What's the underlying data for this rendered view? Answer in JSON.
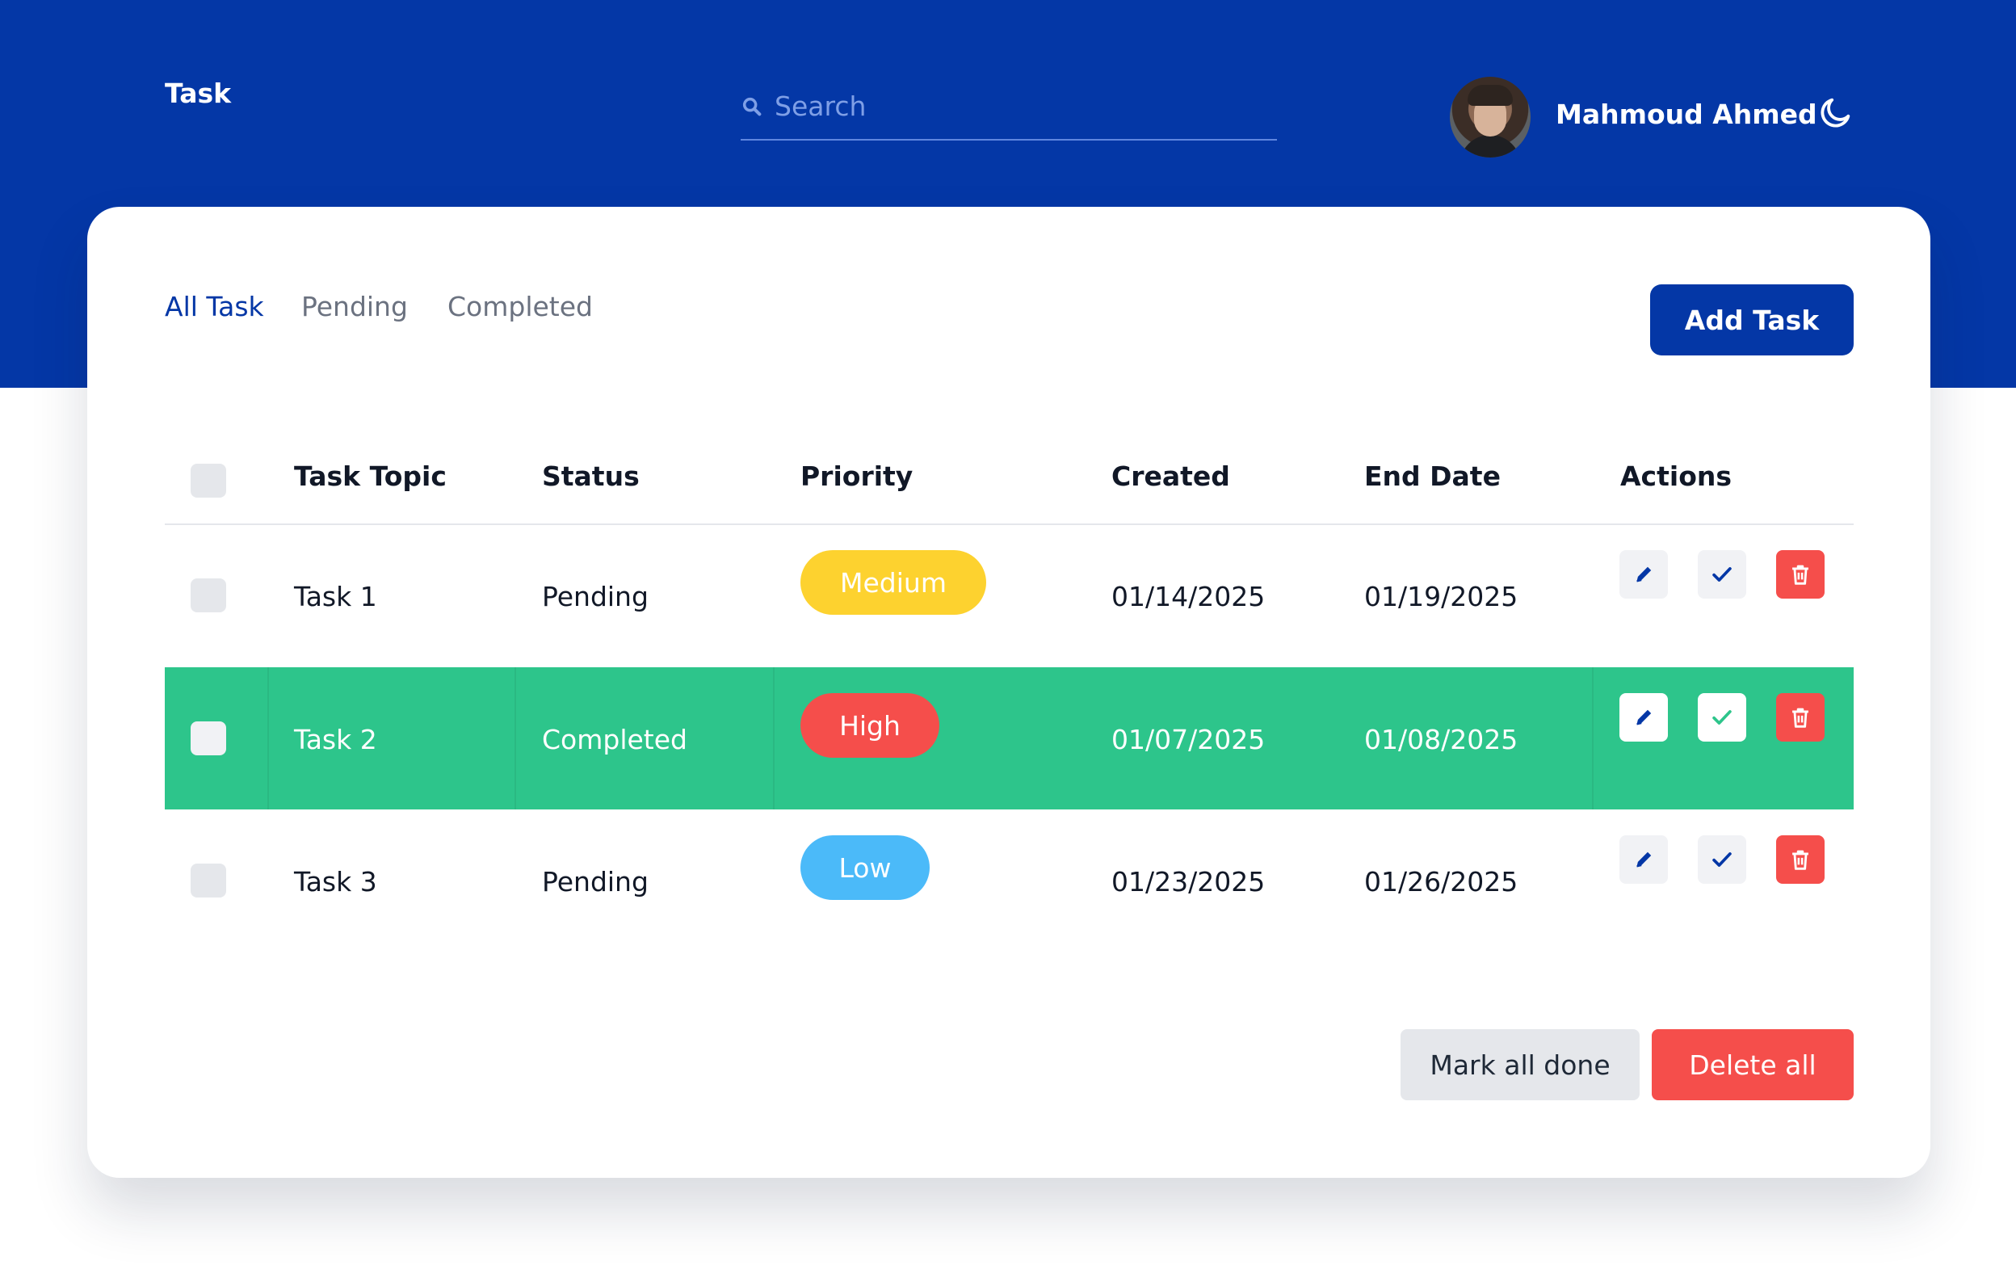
{
  "header": {
    "app_title": "Task",
    "search_placeholder": "Search",
    "search_value": "",
    "user_name": "Mahmoud Ahmed",
    "theme_icon": "moon-icon"
  },
  "tabs": [
    {
      "label": "All Task",
      "active": true
    },
    {
      "label": "Pending",
      "active": false
    },
    {
      "label": "Completed",
      "active": false
    }
  ],
  "add_task_label": "Add Task",
  "table": {
    "columns": [
      "Task Topic",
      "Status",
      "Priority",
      "Created",
      "End Date",
      "Actions"
    ],
    "rows": [
      {
        "topic": "Task 1",
        "status": "Pending",
        "priority": "Medium",
        "created": "01/14/2025",
        "end_date": "01/19/2025",
        "completed": false
      },
      {
        "topic": "Task 2",
        "status": "Completed",
        "priority": "High",
        "created": "01/07/2025",
        "end_date": "01/08/2025",
        "completed": true
      },
      {
        "topic": "Task 3",
        "status": "Pending",
        "priority": "Low",
        "created": "01/23/2025",
        "end_date": "01/26/2025",
        "completed": false
      }
    ],
    "action_icons": [
      "pencil-icon",
      "check-icon",
      "trash-icon"
    ]
  },
  "footer": {
    "mark_all_label": "Mark all done",
    "delete_all_label": "Delete all"
  },
  "colors": {
    "brand": "#0437a6",
    "completed_row": "#2dc58b",
    "priority_medium": "#fdd22f",
    "priority_high": "#f54e4b",
    "priority_low": "#4bbaf9",
    "danger": "#f54e4b"
  }
}
